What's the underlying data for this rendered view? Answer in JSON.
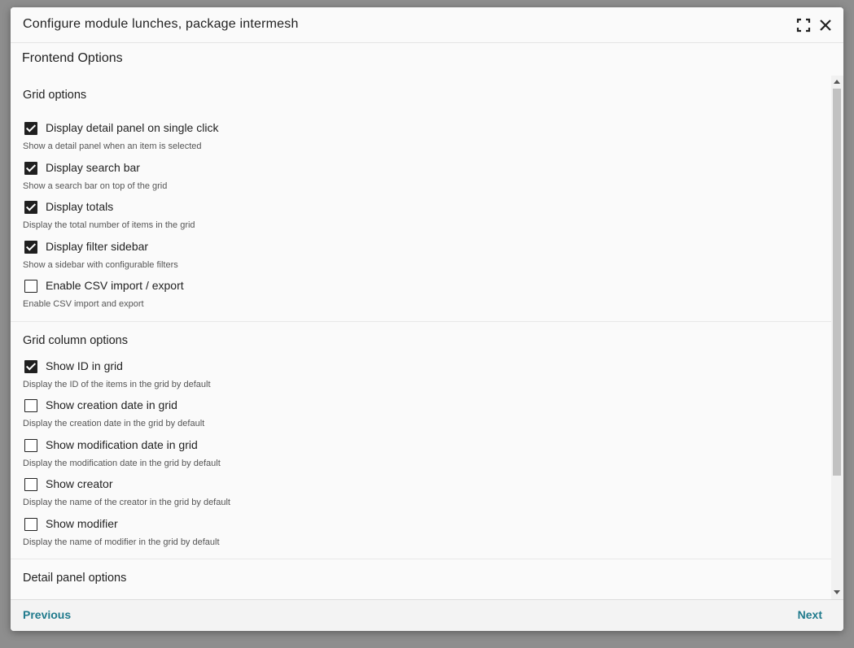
{
  "dialog": {
    "title": "Configure module lunches, package intermesh",
    "section_title": "Frontend Options",
    "icons": {
      "maximize": "maximize-icon",
      "close": "close-icon"
    }
  },
  "groups": [
    {
      "title": "Grid options",
      "options": [
        {
          "label": "Display detail panel on single click",
          "hint": "Show a detail panel when an item is selected",
          "checked": true
        },
        {
          "label": "Display search bar",
          "hint": "Show a search bar on top of the grid",
          "checked": true
        },
        {
          "label": "Display totals",
          "hint": "Display the total number of items in the grid",
          "checked": true
        },
        {
          "label": "Display filter sidebar",
          "hint": "Show a sidebar with configurable filters",
          "checked": true
        },
        {
          "label": "Enable CSV import / export",
          "hint": "Enable CSV import and export",
          "checked": false
        }
      ]
    },
    {
      "title": "Grid column options",
      "options": [
        {
          "label": "Show ID in grid",
          "hint": "Display the ID of the items in the grid by default",
          "checked": true
        },
        {
          "label": "Show creation date in grid",
          "hint": "Display the creation date in the grid by default",
          "checked": false
        },
        {
          "label": "Show modification date in grid",
          "hint": "Display the modification date in the grid by default",
          "checked": false
        },
        {
          "label": "Show creator",
          "hint": "Display the name of the creator in the grid by default",
          "checked": false
        },
        {
          "label": "Show modifier",
          "hint": "Display the name of modifier in the grid by default",
          "checked": false
        }
      ]
    },
    {
      "title": "Detail panel options",
      "options": []
    }
  ],
  "footer": {
    "previous_label": "Previous",
    "next_label": "Next"
  },
  "colors": {
    "accent": "#1f7a8c",
    "checkbox_checked": "#1f1f1f",
    "backdrop": "#8e8e8e"
  }
}
